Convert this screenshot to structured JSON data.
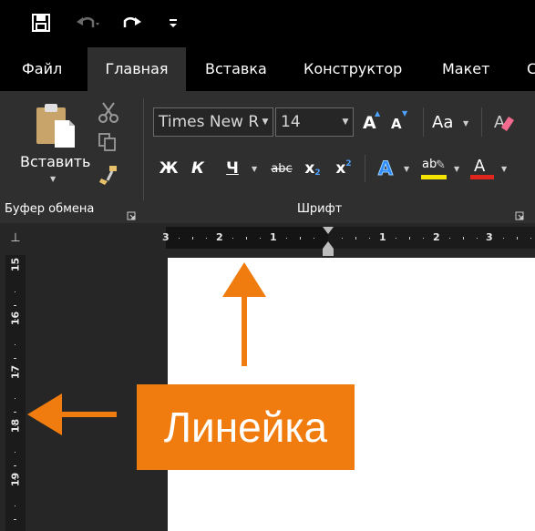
{
  "quick_access": {
    "save_icon": "floppy-disk-icon",
    "undo_icon": "undo-icon",
    "redo_icon": "redo-icon",
    "customize_icon": "customize-qat-icon"
  },
  "tabs": [
    {
      "label": "Файл",
      "active": false
    },
    {
      "label": "Главная",
      "active": true
    },
    {
      "label": "Вставка",
      "active": false
    },
    {
      "label": "Конструктор",
      "active": false
    },
    {
      "label": "Макет",
      "active": false
    },
    {
      "label": "С",
      "active": false
    }
  ],
  "clipboard": {
    "paste_label": "Вставить",
    "group_label": "Буфер обмена"
  },
  "font": {
    "family_value": "Times New R",
    "size_value": "14",
    "group_label": "Шрифт",
    "bold_label": "Ж",
    "italic_label": "К",
    "underline_label": "Ч",
    "strike_label": "abc",
    "subscript_label": "x",
    "subscript_mark": "2",
    "superscript_label": "x",
    "superscript_mark": "2",
    "grow_label": "A",
    "shrink_label": "A",
    "case_label": "Aa",
    "font_color_label": "A",
    "text_effects_label": "A",
    "highlight_label": "ab"
  },
  "ruler": {
    "tab_selector": "⊥",
    "h_labels": [
      "3",
      "2",
      "1",
      "1",
      "2",
      "3"
    ],
    "v_labels": [
      "15",
      "16",
      "17",
      "18",
      "19"
    ]
  },
  "callout": {
    "text": "Линейка"
  },
  "colors": {
    "accent_orange": "#f07c0f",
    "ribbon_bg": "#2f2f2f",
    "highlight_yellow": "#f5e400",
    "font_red": "#e0261c"
  }
}
